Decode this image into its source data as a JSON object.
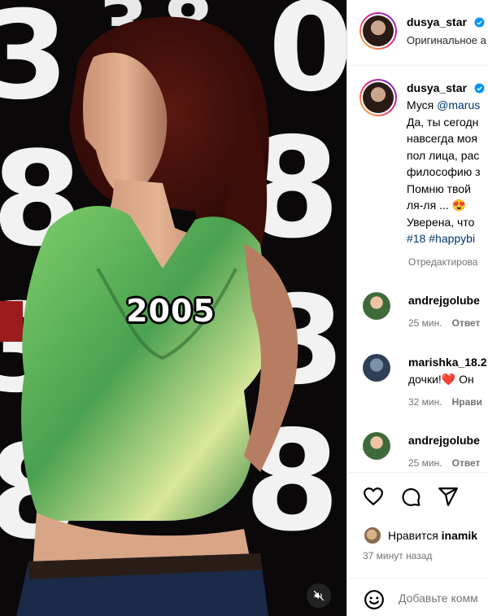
{
  "media": {
    "year_overlay": "2005"
  },
  "header": {
    "username": "dusya_star",
    "subtitle": "Оригинальное а"
  },
  "caption": {
    "username": "dusya_star",
    "lines": [
      {
        "text": "Муся ",
        "mention": "@marus"
      },
      {
        "text": "Да, ты сегодн"
      },
      {
        "text": "навсегда моя"
      },
      {
        "text": "пол лица, рас"
      },
      {
        "text": "философию з"
      },
      {
        "text": "Помню твой"
      },
      {
        "text": "ля-ля ... 😍"
      },
      {
        "text": "Уверена, что"
      },
      {
        "hashtags": "#18 #happybi"
      }
    ],
    "edited": "Отредактирова"
  },
  "comments": [
    {
      "user": "andrejgolube",
      "text": "",
      "time": "25 мин.",
      "action": "Ответ"
    },
    {
      "user": "marishka_18.2",
      "text": "дочки!❤️ Он",
      "time": "32 мин.",
      "action": "Нрави"
    },
    {
      "user": "andrejgolube",
      "text": "",
      "time": "25 мин.",
      "action": "Ответ"
    }
  ],
  "actions": {
    "like_icon": "heart-icon",
    "comment_icon": "comment-bubble-icon",
    "share_icon": "paper-plane-icon"
  },
  "likes": {
    "prefix": "Нравится ",
    "user": "inamik"
  },
  "time_ago": "37 минут назад",
  "add_comment": {
    "placeholder": "Добавьте комм"
  },
  "colors": {
    "link": "#00376b",
    "verified": "#0095f6",
    "muted": "#737373",
    "heart_red": "#ed4956"
  }
}
